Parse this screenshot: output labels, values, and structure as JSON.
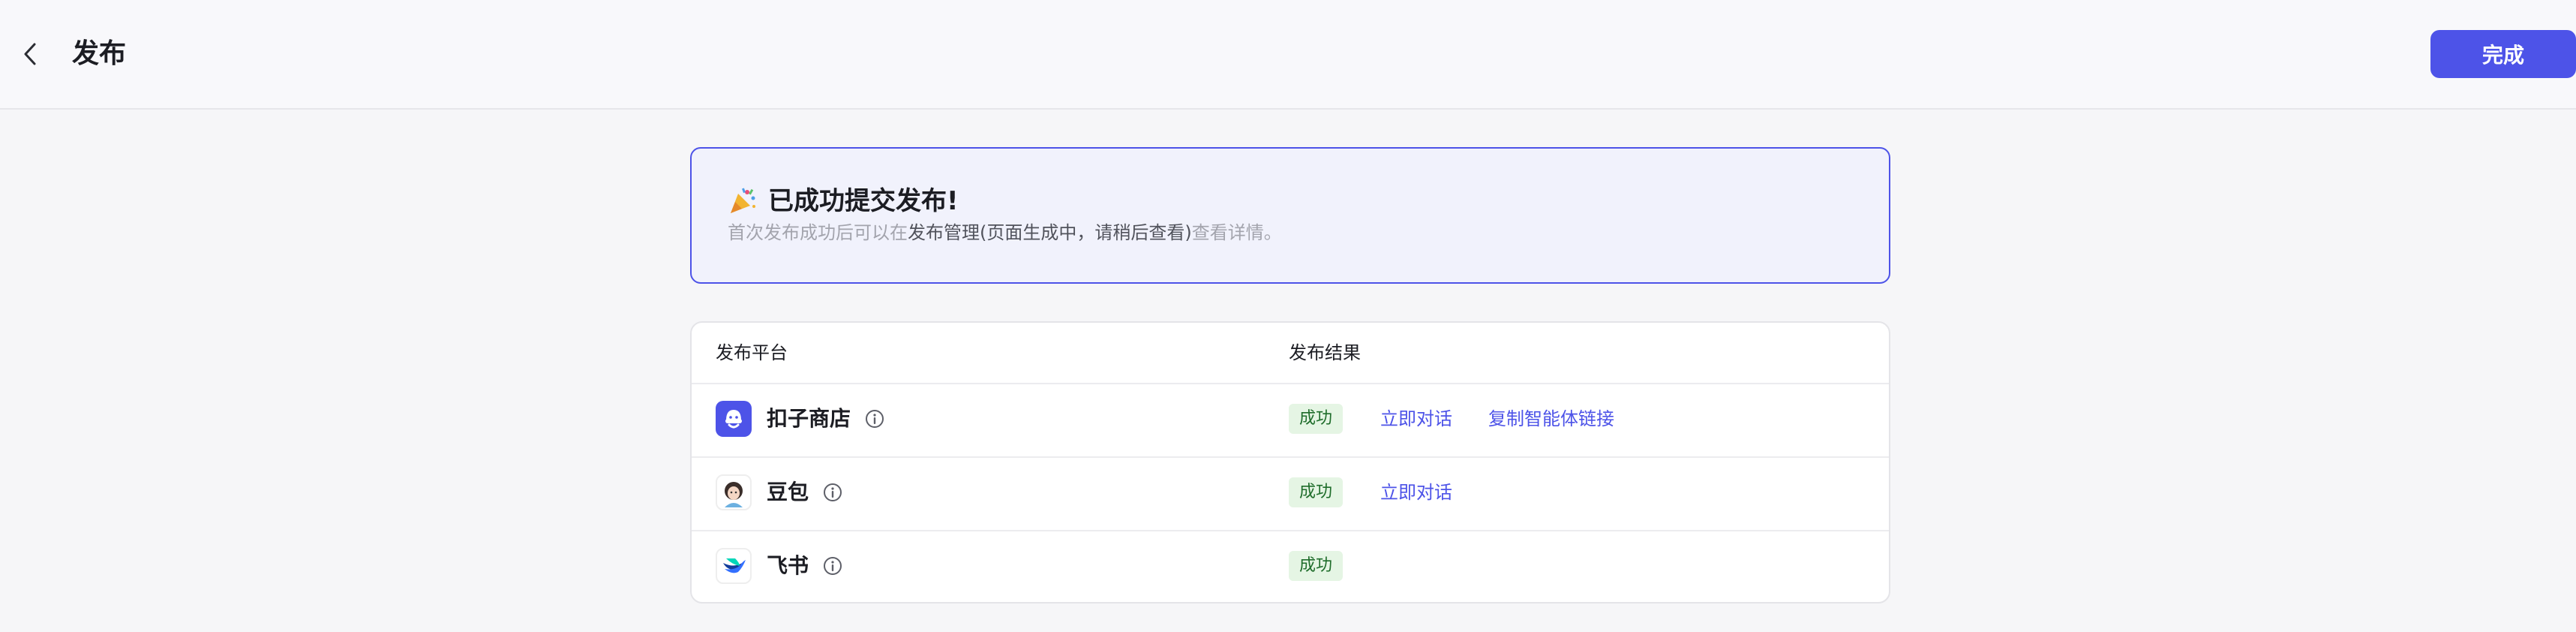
{
  "header": {
    "title": "发布",
    "done_label": "完成"
  },
  "banner": {
    "title": "已成功提交发布!",
    "subtitle_prefix": "首次发布成功后可以在",
    "subtitle_middle": "发布管理(页面生成中，请稍后查看)",
    "subtitle_link": "查看详情。"
  },
  "table": {
    "columns": [
      "发布平台",
      "发布结果"
    ],
    "rows": [
      {
        "name": "扣子商店",
        "status": "成功",
        "actions": [
          "立即对话",
          "复制智能体链接"
        ]
      },
      {
        "name": "豆包",
        "status": "成功",
        "actions": [
          "立即对话"
        ]
      },
      {
        "name": "飞书",
        "status": "成功",
        "actions": []
      }
    ]
  },
  "colors": {
    "accent": "#4d53e8",
    "success_bg": "#e5f5e4",
    "success_text": "#1f6d2b"
  }
}
